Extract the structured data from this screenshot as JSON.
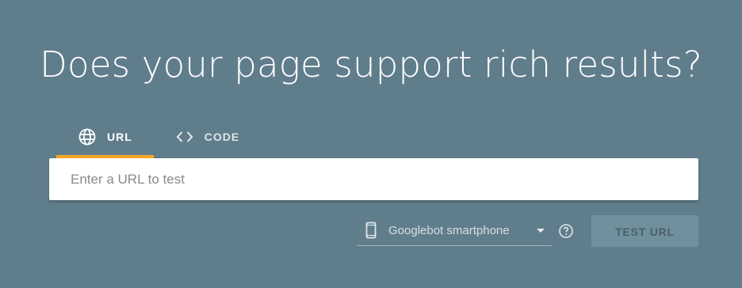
{
  "page": {
    "title": "Does your page support rich results?"
  },
  "tabs": [
    {
      "label": "URL",
      "icon": "globe-icon",
      "active": true
    },
    {
      "label": "CODE",
      "icon": "code-icon",
      "active": false
    }
  ],
  "url_input": {
    "value": "",
    "placeholder": "Enter a URL to test"
  },
  "device_select": {
    "icon": "smartphone-icon",
    "selected": "Googlebot smartphone"
  },
  "help": {
    "icon": "help-circle-icon"
  },
  "test_button": {
    "label": "TEST URL"
  },
  "colors": {
    "background": "#607d8b",
    "active_tab_underline": "#f9a825",
    "button_background": "#71909d"
  }
}
